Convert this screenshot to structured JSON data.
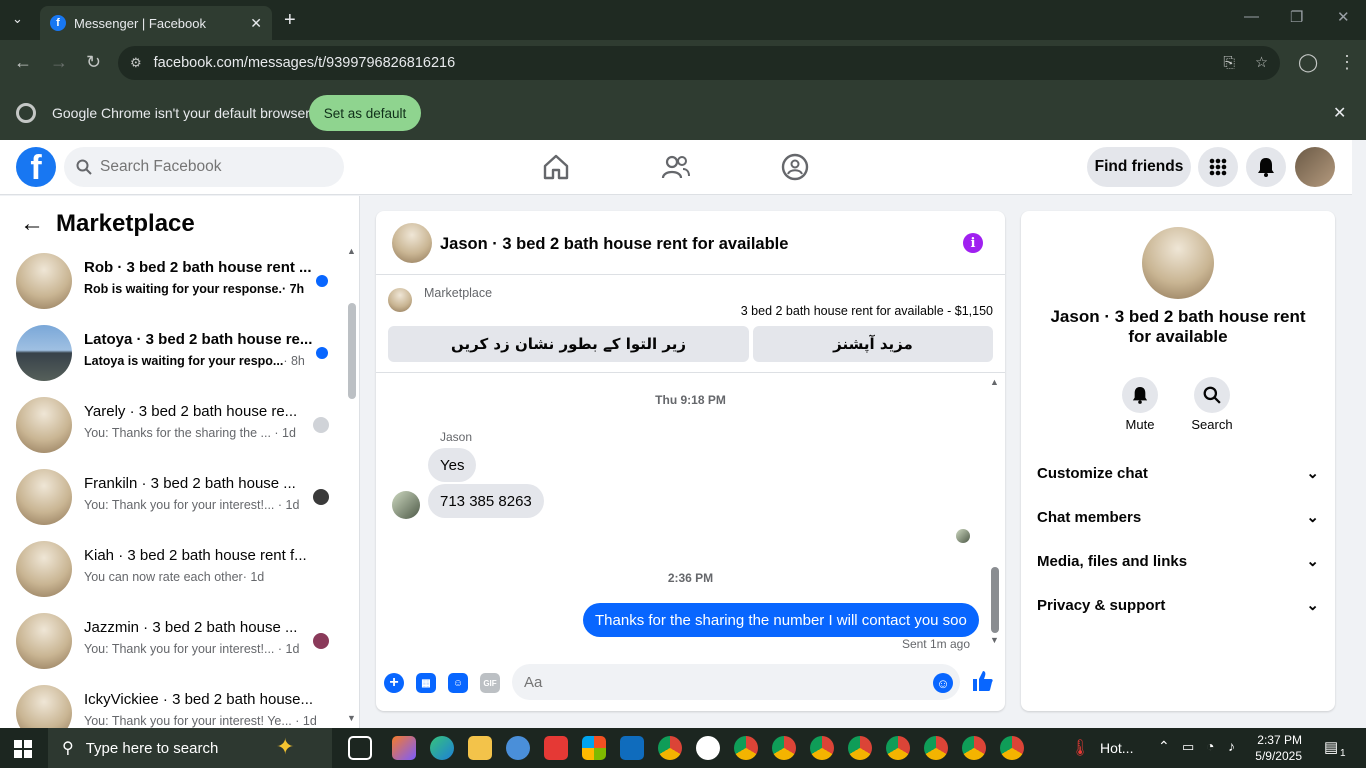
{
  "browser": {
    "tab_title": "Messenger | Facebook",
    "url": "facebook.com/messages/t/9399796826816216",
    "infobar_text": "Google Chrome isn't your default browser",
    "set_default_label": "Set as default"
  },
  "fb_header": {
    "search_placeholder": "Search Facebook",
    "find_friends_label": "Find friends"
  },
  "sidebar": {
    "title": "Marketplace",
    "conversations": [
      {
        "name": "Rob · 3 bed 2 bath house rent ...",
        "preview": "Rob is waiting for your response.",
        "time": "· 7h",
        "unread": true
      },
      {
        "name": "Latoya · 3 bed 2 bath house re...",
        "preview": "Latoya is waiting for your respo...",
        "time": "· 8h",
        "unread": true
      },
      {
        "name": "Yarely · 3 bed 2 bath house re...",
        "preview": "You: Thanks for the sharing the ...",
        "time": "· 1d",
        "unread": false
      },
      {
        "name": "Frankiln · 3 bed 2 bath house ...",
        "preview": "You: Thank you for your interest!...",
        "time": "· 1d",
        "unread": false
      },
      {
        "name": "Kiah · 3 bed 2 bath house rent f...",
        "preview": "You can now rate each other",
        "time": "· 1d",
        "unread": false
      },
      {
        "name": "Jazzmin · 3 bed 2 bath house ...",
        "preview": "You: Thank you for your interest!...",
        "time": "· 1d",
        "unread": false
      },
      {
        "name": "IckyVickiee · 3 bed 2 bath house...",
        "preview": "You: Thank you for your interest! Ye...",
        "time": "· 1d",
        "unread": false
      }
    ]
  },
  "chat": {
    "title": "Jason · 3 bed 2 bath house rent for available",
    "marketplace_label": "Marketplace",
    "listing": "3 bed 2 bath house rent for available - $1,150",
    "btn_mark_pending": "زیر التوا کے بطور نشان زد کریں",
    "btn_more_options": "مزید آپشنز",
    "timestamp1": "Thu 9:18 PM",
    "sender_name": "Jason",
    "msg1": "Yes",
    "msg2": "713 385 8263",
    "timestamp2": "2:36 PM",
    "msg3": "Thanks for the sharing the number I will contact you soo",
    "sent_status": "Sent 1m ago",
    "composer_placeholder": "Aa"
  },
  "details": {
    "name": "Jason · 3 bed 2 bath house rent for available",
    "mute_label": "Mute",
    "search_label": "Search",
    "rows": [
      "Customize chat",
      "Chat members",
      "Media, files and links",
      "Privacy & support"
    ]
  },
  "taskbar": {
    "search_placeholder": "Type here to search",
    "weather": "Hot...",
    "time": "2:37 PM",
    "date": "5/9/2025",
    "notif_count": "1"
  },
  "colors": {
    "fb_blue": "#0866ff",
    "info_purple": "#a020f0",
    "set_default_green": "#8fd48f"
  }
}
